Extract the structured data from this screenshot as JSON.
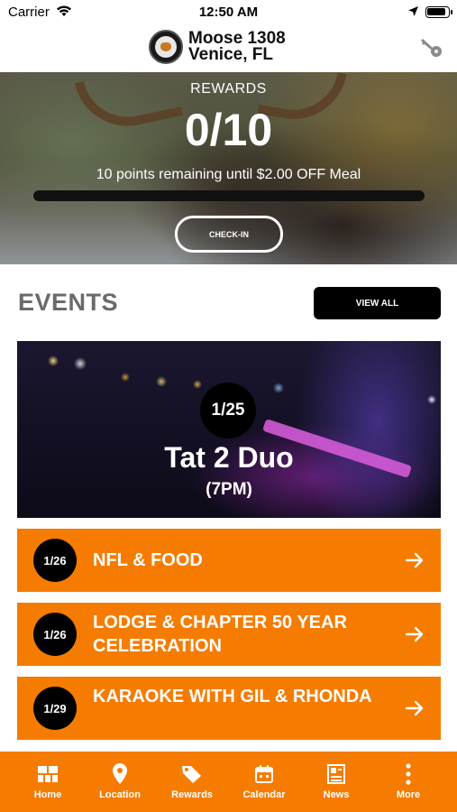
{
  "status_bar": {
    "carrier": "Carrier",
    "time": "12:50 AM"
  },
  "header": {
    "line1": "Moose 1308",
    "line2": "Venice, FL"
  },
  "rewards": {
    "label": "REWARDS",
    "points": "0/10",
    "remaining_text": "10 points remaining until $2.00 OFF Meal",
    "progress_fraction": 0,
    "checkin_label": "CHECK-IN"
  },
  "events": {
    "title": "EVENTS",
    "view_all_label": "VIEW ALL",
    "featured": {
      "date": "1/25",
      "name": "Tat 2 Duo",
      "time": "(7PM)"
    },
    "items": [
      {
        "date": "1/26",
        "title": "NFL & FOOD"
      },
      {
        "date": "1/26",
        "title": "LODGE & CHAPTER 50 YEAR CELEBRATION"
      },
      {
        "date": "1/29",
        "title": "KARAOKE WITH GIL & RHONDA"
      }
    ]
  },
  "tabbar": {
    "items": [
      {
        "label": "Home",
        "icon": "grid-icon"
      },
      {
        "label": "Location",
        "icon": "map-pin-icon"
      },
      {
        "label": "Rewards",
        "icon": "tag-icon"
      },
      {
        "label": "Calendar",
        "icon": "calendar-icon"
      },
      {
        "label": "News",
        "icon": "newspaper-icon"
      },
      {
        "label": "More",
        "icon": "more-vertical-icon"
      }
    ]
  },
  "colors": {
    "accent": "#f57c00",
    "dark": "#000000",
    "heading_gray": "#6a6a6a"
  }
}
